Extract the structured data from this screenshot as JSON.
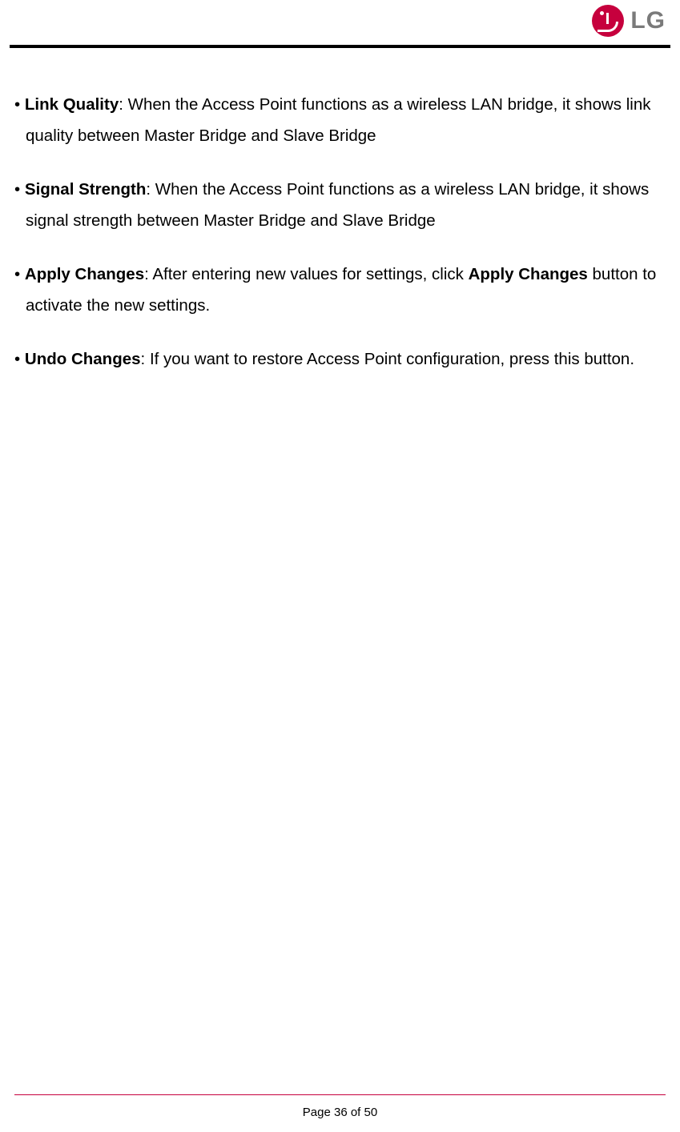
{
  "logo": {
    "text": "LG"
  },
  "items": [
    {
      "term": "Link Quality",
      "text_after_term": ": When the Access Point functions as a wireless LAN bridge, it shows link",
      "continuation": "quality between Master Bridge and Slave Bridge"
    },
    {
      "term": "Signal Strength",
      "text_after_term": ": When the Access Point functions as a wireless LAN bridge, it shows",
      "continuation": "signal strength between Master Bridge and Slave Bridge"
    },
    {
      "term": "Apply Changes",
      "text_after_term": ": After entering new values for settings, click ",
      "inline_bold": "Apply Changes",
      "text_after_bold": " button to",
      "continuation": "activate the new settings."
    },
    {
      "term": "Undo Changes",
      "text_after_term": ": If you want to restore Access Point configuration, press this button.",
      "continuation": ""
    }
  ],
  "footer": {
    "page_label": "Page 36 of 50"
  },
  "bullet_char": "•"
}
